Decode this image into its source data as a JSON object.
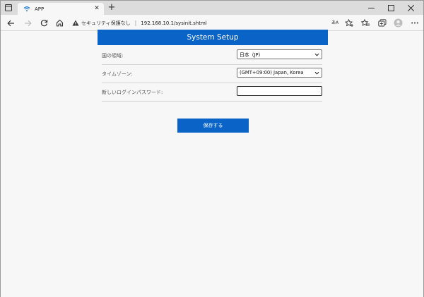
{
  "browser": {
    "tab_title": "APP",
    "address_label": "セキュリティ保護なし",
    "address_separator": "|",
    "url": "192.168.10.1/sysinit.shtml",
    "read_aloud": "あA"
  },
  "page": {
    "header_title": "System Setup",
    "rows": [
      {
        "label": "国の領域:",
        "value": "日本（JP)"
      },
      {
        "label": "タイムゾーン:",
        "value": "(GMT+09:00) Japan, Korea"
      },
      {
        "label": "新しいログインパスワード:",
        "value": ""
      }
    ],
    "save_label": "保存する"
  },
  "colors": {
    "accent": "#0a64c8"
  }
}
